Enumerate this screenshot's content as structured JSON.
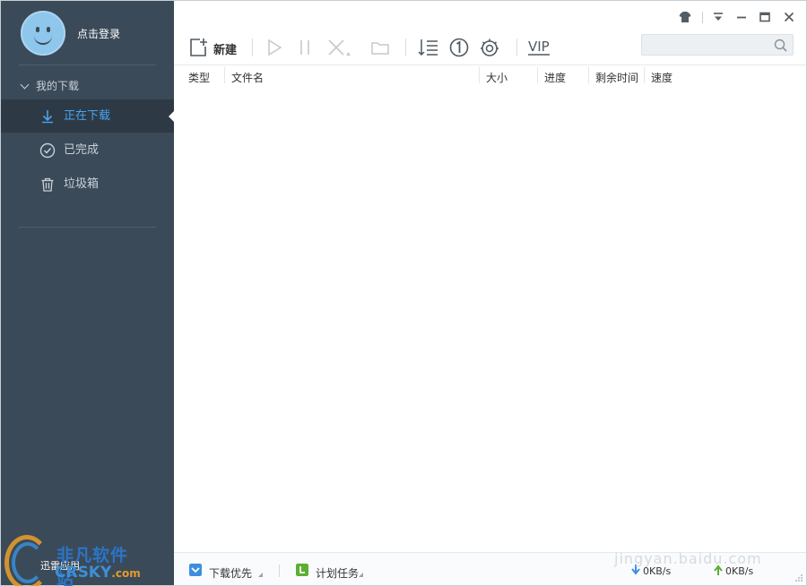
{
  "sidebar": {
    "login_text": "点击登录",
    "group_label": "我的下载",
    "items": [
      {
        "label": "正在下载",
        "icon": "download-arrow-icon",
        "active": true
      },
      {
        "label": "已完成",
        "icon": "check-circle-icon",
        "active": false
      },
      {
        "label": "垃圾箱",
        "icon": "trash-icon",
        "active": false
      }
    ]
  },
  "toolbar": {
    "new_label": "新建",
    "vip_label": "VIP",
    "search_placeholder": ""
  },
  "columns": {
    "type": "类型",
    "filename": "文件名",
    "size": "大小",
    "progress": "进度",
    "remaining": "剩余时间",
    "speed": "速度"
  },
  "statusbar": {
    "download_priority": "下载优先",
    "scheduled_task": "计划任务",
    "download_speed": "0KB/s",
    "upload_speed": "0KB/s"
  },
  "watermark": {
    "title": "非凡软件站",
    "site": "CRSKY",
    "site_suffix": ".com",
    "small": "迅雷应用",
    "url": "jingyan.baidu.com"
  },
  "colors": {
    "sidebar_bg": "#3b4a58",
    "active_bg": "#2d3a46",
    "accent_blue": "#4aa3ee",
    "status_check_blue": "#3e8ede",
    "status_check_green": "#5cae33"
  }
}
